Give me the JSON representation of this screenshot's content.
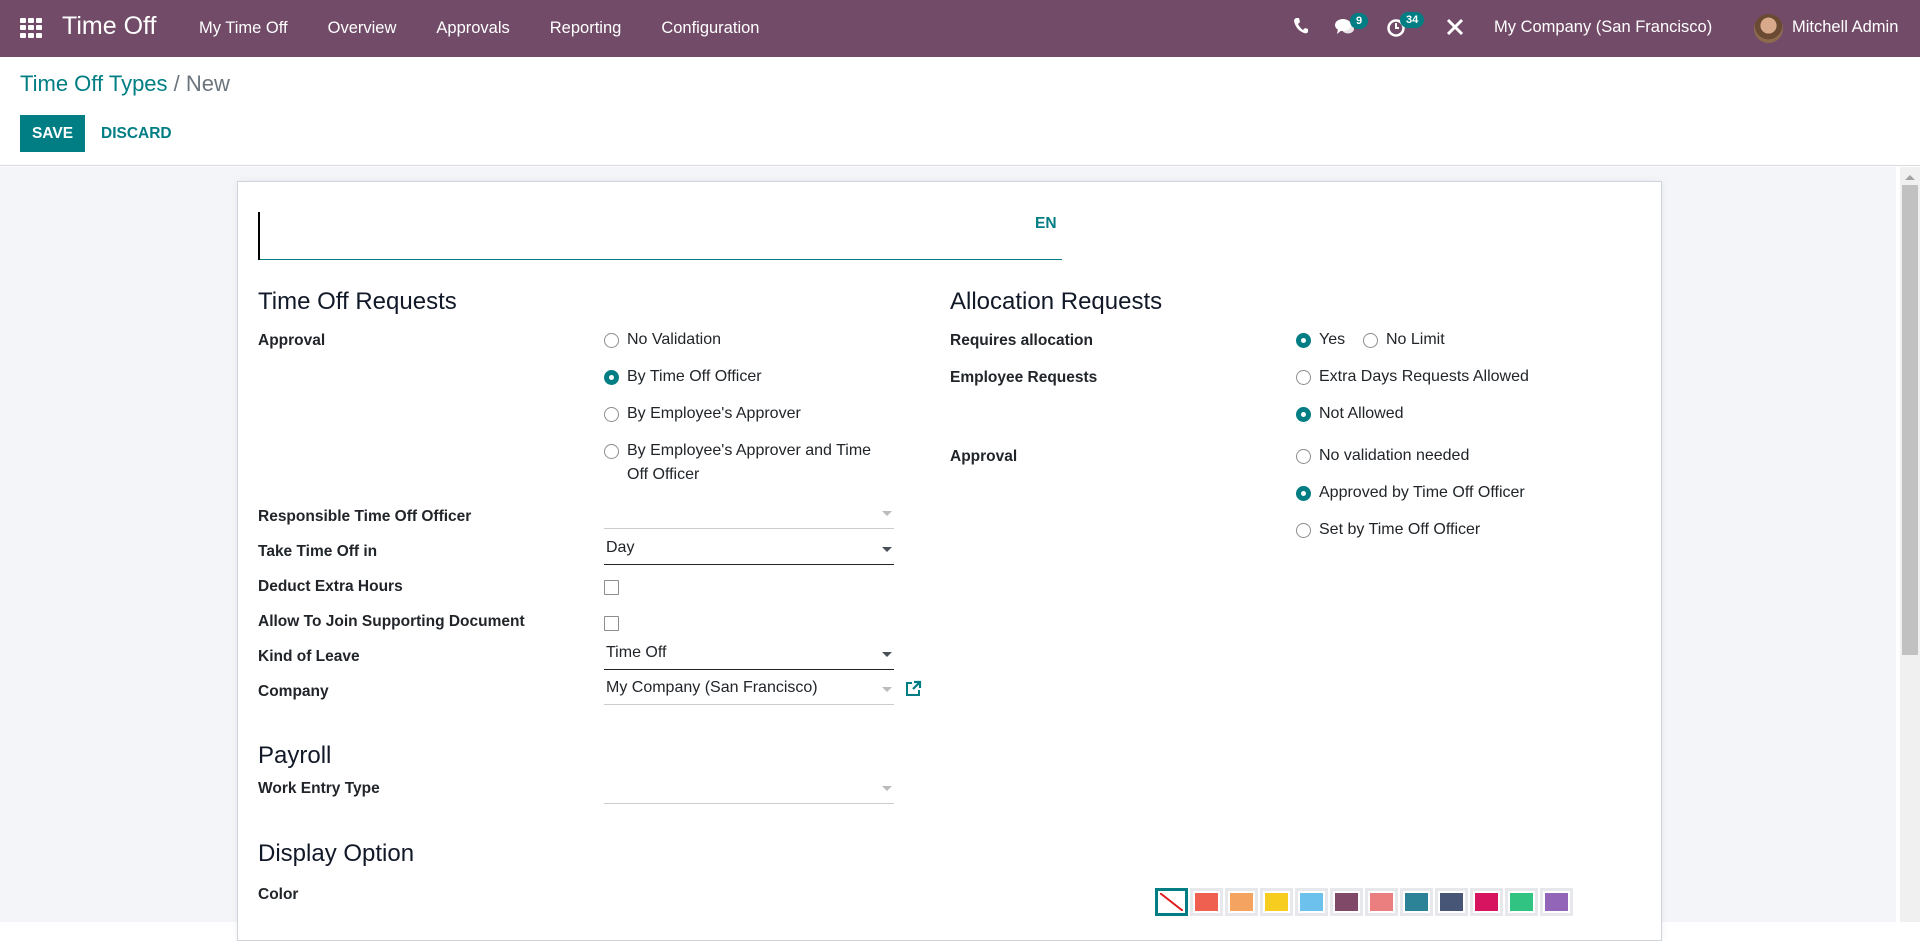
{
  "navbar": {
    "app_icon": "apps-grid-icon",
    "app_name": "Time Off",
    "menu": [
      "My Time Off",
      "Overview",
      "Approvals",
      "Reporting",
      "Configuration"
    ],
    "systray": {
      "phone_icon": "phone-icon",
      "messages_icon": "chat-icon",
      "messages_count": "9",
      "activities_icon": "clock-icon",
      "activities_count": "34",
      "tools_icon": "debug-tools-icon"
    },
    "company": "My Company (San Francisco)",
    "user": "Mitchell Admin"
  },
  "breadcrumb": {
    "parent": "Time Off Types",
    "separator": " / ",
    "current": "New"
  },
  "buttons": {
    "save": "SAVE",
    "discard": "DISCARD"
  },
  "form": {
    "name_value": "",
    "lang": "EN",
    "time_off_requests": {
      "title": "Time Off Requests",
      "approval_label": "Approval",
      "approval_options": [
        {
          "label": "No Validation",
          "selected": false
        },
        {
          "label": "By Time Off Officer",
          "selected": true
        },
        {
          "label": "By Employee's Approver",
          "selected": false
        },
        {
          "label": "By Employee's Approver and Time Off Officer",
          "selected": false
        }
      ],
      "responsible_label": "Responsible Time Off Officer",
      "responsible_value": "",
      "take_in_label": "Take Time Off in",
      "take_in_value": "Day",
      "deduct_label": "Deduct Extra Hours",
      "deduct_checked": false,
      "support_doc_label": "Allow To Join Supporting Document",
      "support_doc_checked": false,
      "kind_label": "Kind of Leave",
      "kind_value": "Time Off",
      "company_label": "Company",
      "company_value": "My Company (San Francisco)"
    },
    "allocation_requests": {
      "title": "Allocation Requests",
      "requires_label": "Requires allocation",
      "requires_options": [
        {
          "label": "Yes",
          "selected": true
        },
        {
          "label": "No Limit",
          "selected": false
        }
      ],
      "employee_label": "Employee Requests",
      "employee_options": [
        {
          "label": "Extra Days Requests Allowed",
          "selected": false
        },
        {
          "label": "Not Allowed",
          "selected": true
        }
      ],
      "approval_label": "Approval",
      "approval_options": [
        {
          "label": "No validation needed",
          "selected": false
        },
        {
          "label": "Approved by Time Off Officer",
          "selected": true
        },
        {
          "label": "Set by Time Off Officer",
          "selected": false
        }
      ]
    },
    "payroll": {
      "title": "Payroll",
      "work_entry_label": "Work Entry Type",
      "work_entry_value": ""
    },
    "display": {
      "title": "Display Option",
      "color_label": "Color",
      "colors": [
        "none",
        "#f06050",
        "#f4a460",
        "#f7cd1f",
        "#6cc1ed",
        "#814968",
        "#eb7e7f",
        "#2c8397",
        "#475577",
        "#d6145f",
        "#30c381",
        "#9365b8"
      ],
      "selected_color_index": 0
    }
  },
  "theme": {
    "brand": "#714b67",
    "accent": "#017e84"
  }
}
